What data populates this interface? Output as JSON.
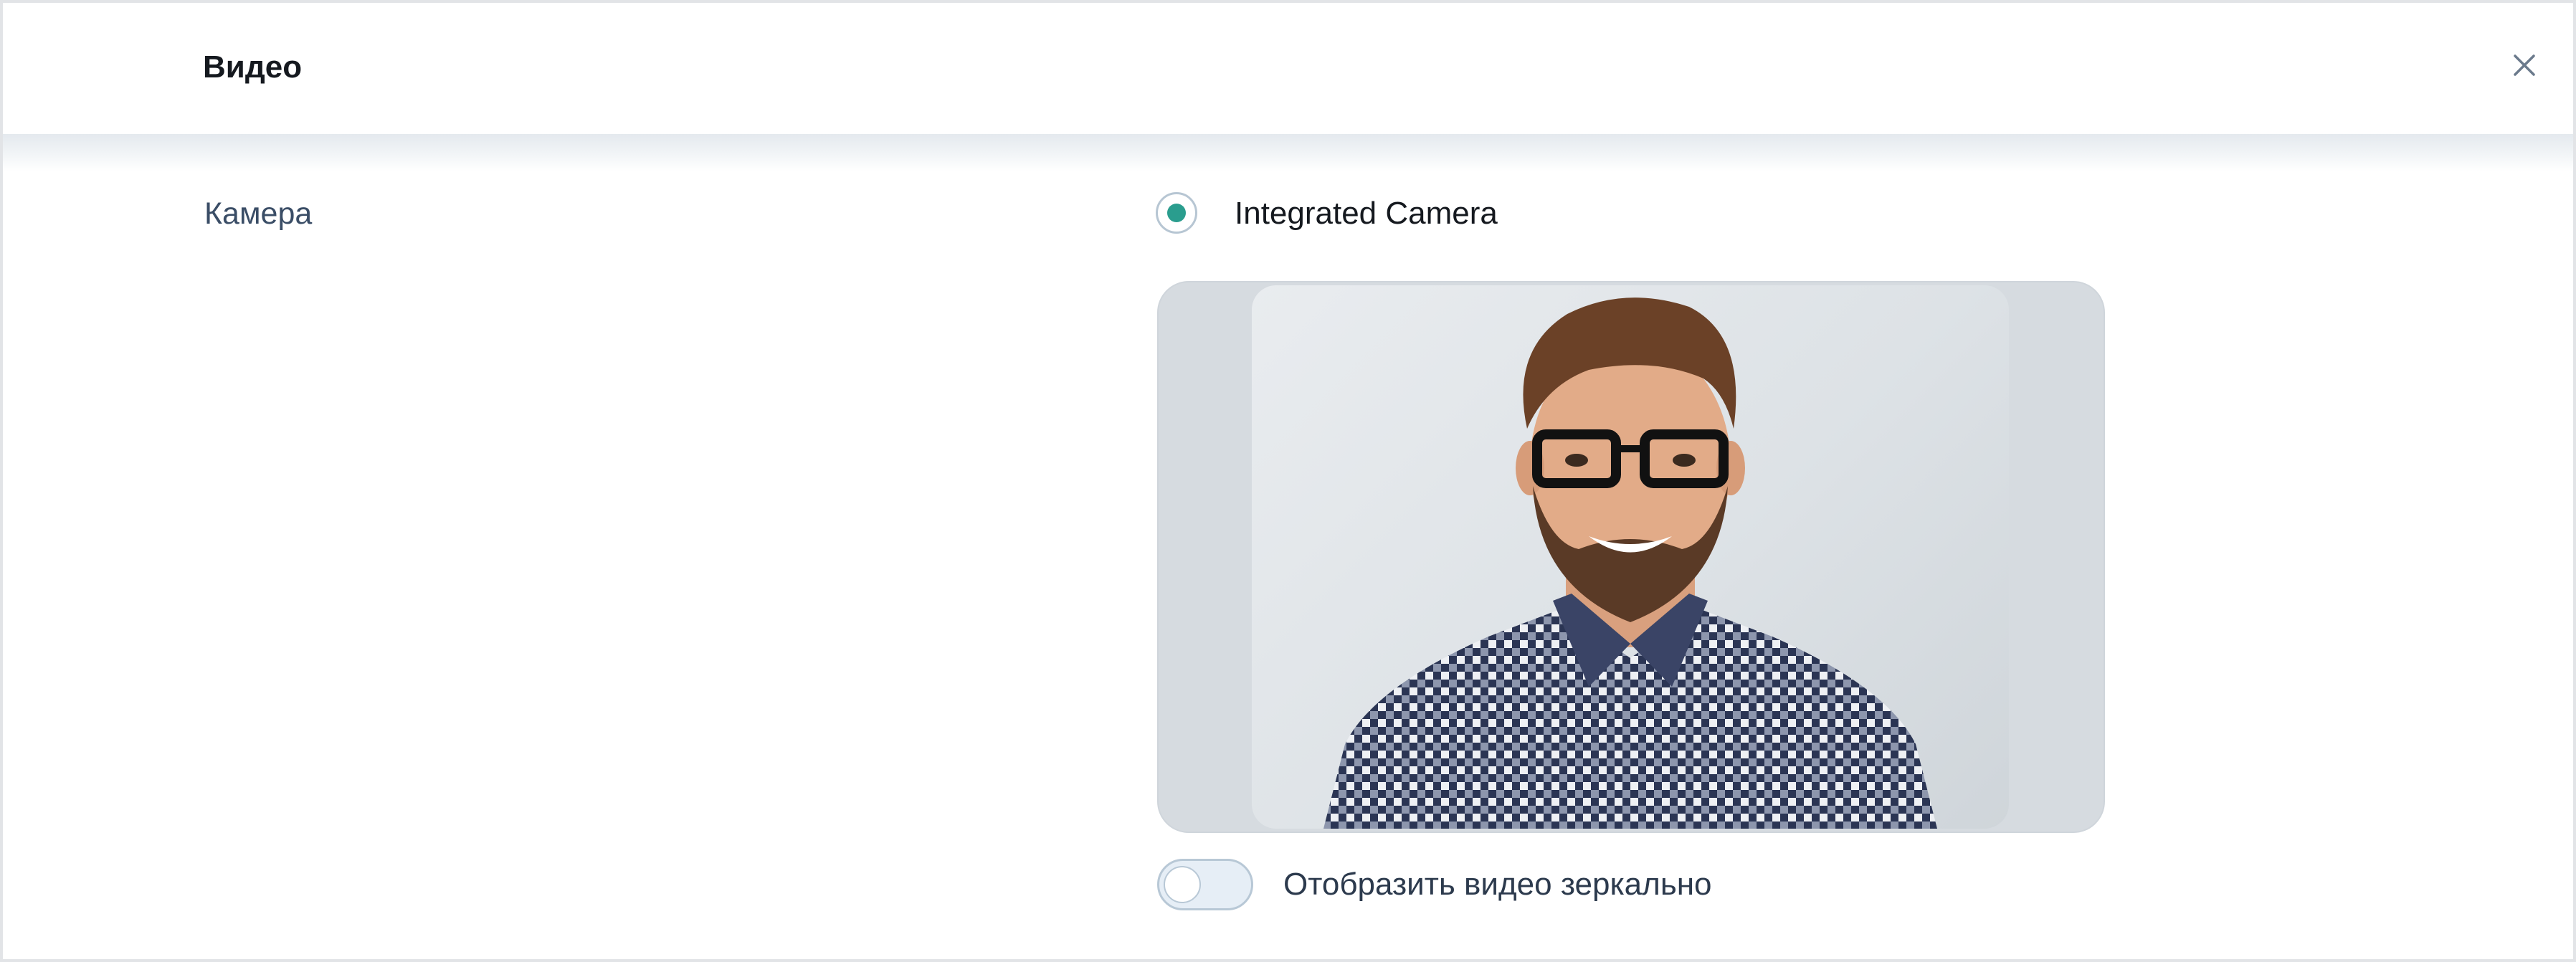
{
  "dialog": {
    "title": "Видео",
    "close_icon": "close-icon"
  },
  "camera": {
    "label": "Камера",
    "options": [
      {
        "label": "Integrated Camera",
        "selected": true
      }
    ],
    "preview_icon": "camera-preview"
  },
  "mirror": {
    "label": "Отобразить видео зеркально",
    "enabled": false
  },
  "colors": {
    "accent": "#2a9d8e",
    "label_text": "#3a4d66",
    "border": "#b8c8d6"
  }
}
